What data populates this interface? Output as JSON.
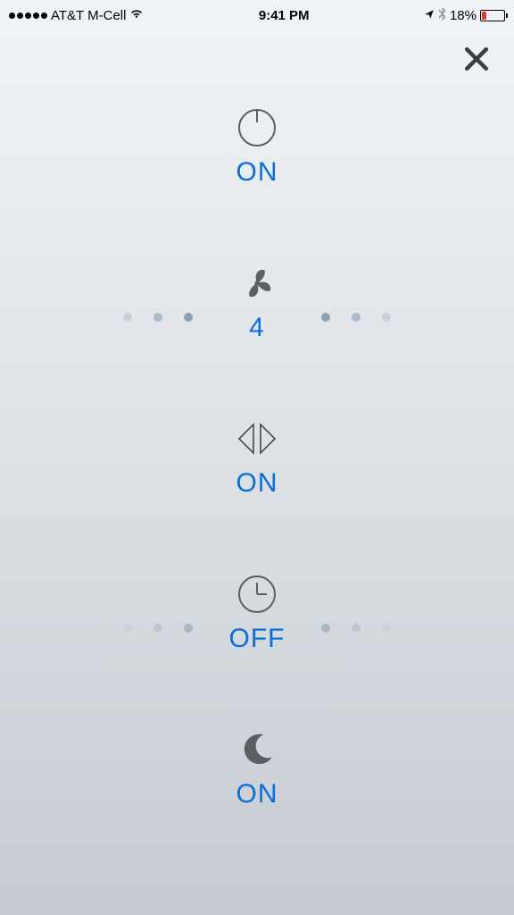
{
  "status_bar": {
    "carrier": "AT&T M-Cell",
    "time": "9:41 PM",
    "battery_pct": "18%"
  },
  "colors": {
    "accent": "#0a6dd9",
    "icon": "#5b5f63",
    "dot_active": "#86a2b7",
    "dot_inactive": "#c4d1da",
    "dot_inactive2": "#b9c4cd"
  },
  "controls": {
    "power": {
      "value": "ON"
    },
    "fan": {
      "value": "4"
    },
    "swing": {
      "value": "ON"
    },
    "timer": {
      "value": "OFF"
    },
    "night": {
      "value": "ON"
    }
  }
}
